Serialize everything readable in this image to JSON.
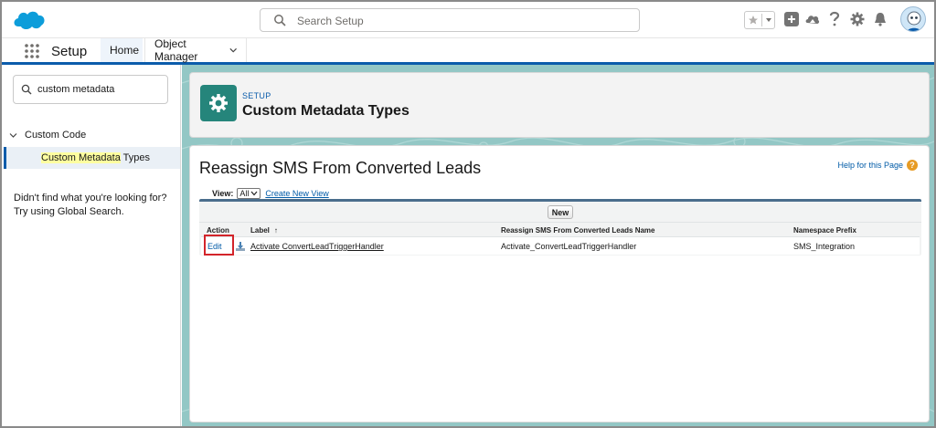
{
  "global_header": {
    "search_placeholder": "Search Setup"
  },
  "nav": {
    "app_name": "Setup",
    "tabs": [
      {
        "label": "Home"
      },
      {
        "label": "Object Manager"
      }
    ]
  },
  "sidebar": {
    "quick_find_value": "custom metadata",
    "tree": {
      "node_label": "Custom Code",
      "leaf_highlight": "Custom Metadata",
      "leaf_rest": " Types"
    },
    "not_found_line1": "Didn't find what you're looking for?",
    "not_found_line2": "Try using Global Search."
  },
  "page_header": {
    "eyebrow": "SETUP",
    "title": "Custom Metadata Types"
  },
  "main": {
    "title": "Reassign SMS From Converted Leads",
    "help_link": "Help for this Page",
    "view_label": "View:",
    "view_selected": "All",
    "create_view_link": "Create New View",
    "new_button": "New",
    "columns": [
      {
        "label": "Action"
      },
      {
        "label": "Label",
        "sort_indicator": "↑"
      },
      {
        "label": "Reassign SMS From Converted Leads Name"
      },
      {
        "label": "Namespace Prefix"
      }
    ],
    "rows": [
      {
        "action": "Edit",
        "label": "Activate ConvertLeadTriggerHandler",
        "name": "Activate_ConvertLeadTriggerHandler",
        "namespace": "SMS_Integration"
      }
    ]
  },
  "colors": {
    "brand_blue": "#0b5cab",
    "setup_icon_teal": "#25857b",
    "background_teal": "#93c7c5",
    "highlight_red": "#d3242a",
    "help_orange": "#e79b24"
  },
  "icons": [
    "salesforce-cloud-logo",
    "search-icon",
    "star-icon",
    "add-icon",
    "trailhead-icon",
    "help-icon",
    "gear-icon",
    "bell-icon",
    "avatar",
    "app-launcher-icon",
    "chevron-down-icon",
    "setup-gear-icon",
    "download-icon"
  ]
}
